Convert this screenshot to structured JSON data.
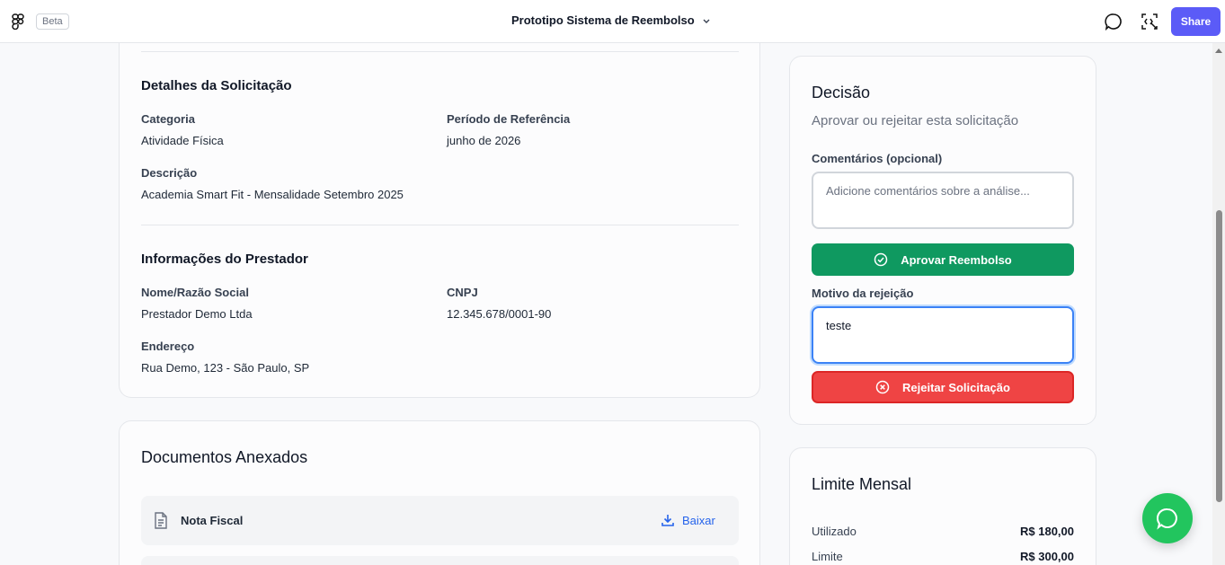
{
  "topbar": {
    "beta_label": "Beta",
    "project_title": "Prototipo Sistema de Reembolso",
    "share_label": "Share"
  },
  "details": {
    "section_title": "Detalhes da Solicitação",
    "category_label": "Categoria",
    "category_value": "Atividade Física",
    "period_label": "Período de Referência",
    "period_value": "junho de 2026",
    "description_label": "Descrição",
    "description_value": "Academia Smart Fit - Mensalidade Setembro 2025"
  },
  "provider": {
    "section_title": "Informações do Prestador",
    "name_label": "Nome/Razão Social",
    "name_value": "Prestador Demo Ltda",
    "cnpj_label": "CNPJ",
    "cnpj_value": "12.345.678/0001-90",
    "address_label": "Endereço",
    "address_value": "Rua Demo, 123 - São Paulo, SP"
  },
  "documents": {
    "title": "Documentos Anexados",
    "items": [
      {
        "name": "Nota Fiscal",
        "download_label": "Baixar"
      }
    ]
  },
  "decision": {
    "title": "Decisão",
    "subtitle": "Aprovar ou rejeitar esta solicitação",
    "comments_label": "Comentários (opcional)",
    "comments_placeholder": "Adicione comentários sobre a análise...",
    "comments_value": "",
    "approve_label": "Aprovar Reembolso",
    "reason_label": "Motivo da rejeição",
    "reason_value": "teste",
    "reject_label": "Rejeitar Solicitação"
  },
  "limit": {
    "title": "Limite Mensal",
    "used_label": "Utilizado",
    "used_value": "R$ 180,00",
    "limit_label": "Limite",
    "limit_value": "R$ 300,00"
  },
  "colors": {
    "accent": "#5b5bf7",
    "approve": "#0f9960",
    "reject": "#ef4444",
    "link": "#2563eb",
    "whatsapp": "#22c55e"
  }
}
